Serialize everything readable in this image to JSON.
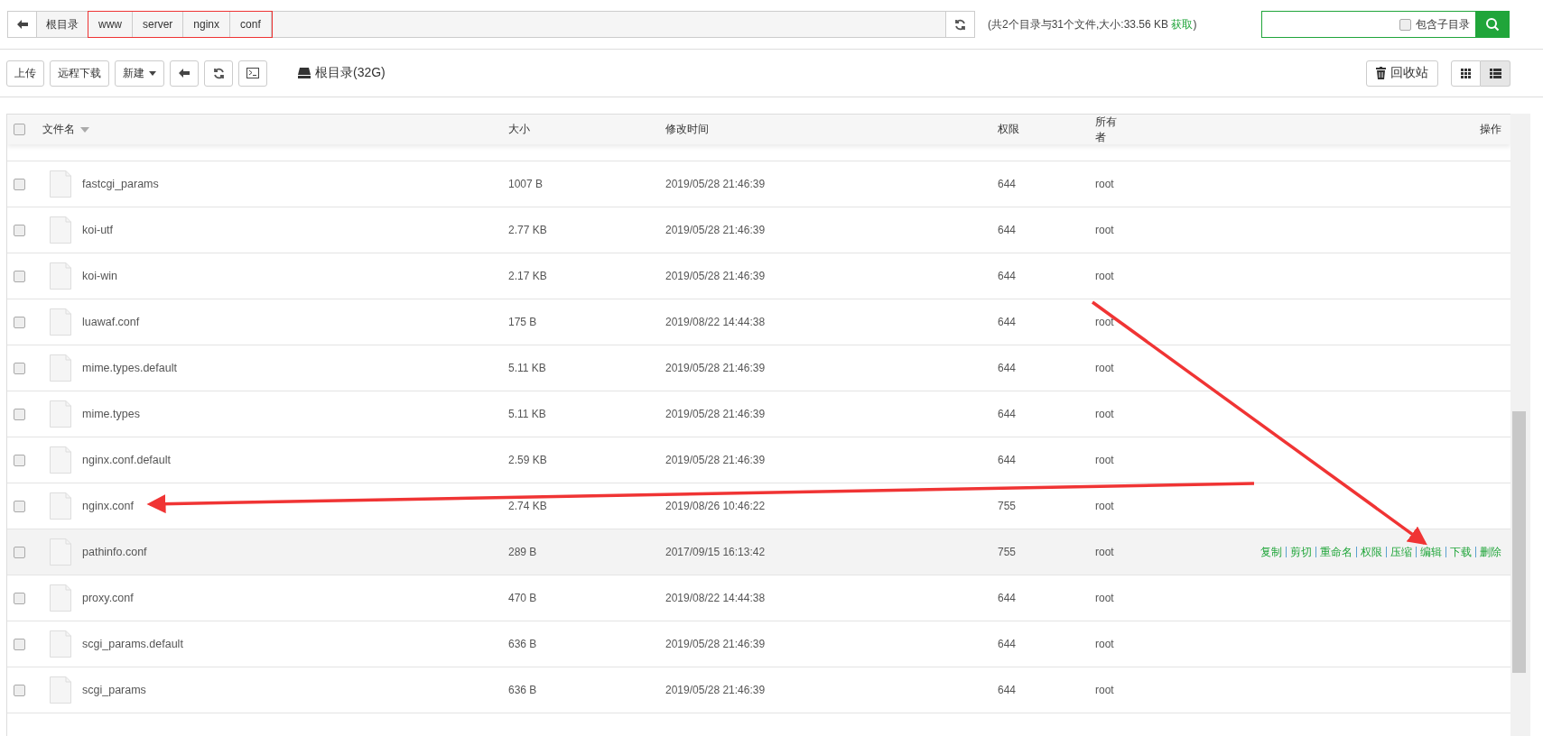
{
  "path_bar": {
    "root": "根目录",
    "segments": [
      "www",
      "server",
      "nginx",
      "conf"
    ],
    "highlighted": true
  },
  "summary": {
    "text": "(共2个目录与31个文件,大小:33.56 KB",
    "link": "获取",
    "close": ")"
  },
  "search": {
    "option_label": "包含子目录",
    "option_checked": false
  },
  "toolbar": {
    "buttons": [
      "上传",
      "远程下载"
    ],
    "new_button": "新建",
    "disk": "根目录(32G)",
    "recycle": "回收站",
    "views": [
      {
        "kind": "grid",
        "selected": false
      },
      {
        "kind": "list",
        "selected": true
      }
    ]
  },
  "table": {
    "columns": [
      "文件名",
      "大小",
      "修改时间",
      "权限",
      "所有者",
      "操作"
    ],
    "header_checked": false,
    "rows": [
      {
        "name": "fastcgi_params",
        "size": "1007 B",
        "modified": "2019/05/28 21:46:39",
        "permission": "644",
        "owner": "root",
        "checked": false,
        "highlighted": false
      },
      {
        "name": "koi-utf",
        "size": "2.77 KB",
        "modified": "2019/05/28 21:46:39",
        "permission": "644",
        "owner": "root",
        "checked": false,
        "highlighted": false
      },
      {
        "name": "koi-win",
        "size": "2.17 KB",
        "modified": "2019/05/28 21:46:39",
        "permission": "644",
        "owner": "root",
        "checked": false,
        "highlighted": false
      },
      {
        "name": "luawaf.conf",
        "size": "175 B",
        "modified": "2019/08/22 14:44:38",
        "permission": "644",
        "owner": "root",
        "checked": false,
        "highlighted": false
      },
      {
        "name": "mime.types.default",
        "size": "5.11 KB",
        "modified": "2019/05/28 21:46:39",
        "permission": "644",
        "owner": "root",
        "checked": false,
        "highlighted": false
      },
      {
        "name": "mime.types",
        "size": "5.11 KB",
        "modified": "2019/05/28 21:46:39",
        "permission": "644",
        "owner": "root",
        "checked": false,
        "highlighted": false
      },
      {
        "name": "nginx.conf.default",
        "size": "2.59 KB",
        "modified": "2019/05/28 21:46:39",
        "permission": "644",
        "owner": "root",
        "checked": false,
        "highlighted": false
      },
      {
        "name": "nginx.conf",
        "size": "2.74 KB",
        "modified": "2019/08/26 10:46:22",
        "permission": "755",
        "owner": "root",
        "checked": false,
        "highlighted": false
      },
      {
        "name": "pathinfo.conf",
        "size": "289 B",
        "modified": "2017/09/15 16:13:42",
        "permission": "755",
        "owner": "root",
        "checked": false,
        "highlighted": true,
        "actions": [
          "复制",
          "剪切",
          "重命名",
          "权限",
          "压缩",
          "编辑",
          "下载",
          "删除"
        ]
      },
      {
        "name": "proxy.conf",
        "size": "470 B",
        "modified": "2019/08/22 14:44:38",
        "permission": "644",
        "owner": "root",
        "checked": false,
        "highlighted": false
      },
      {
        "name": "scgi_params.default",
        "size": "636 B",
        "modified": "2019/05/28 21:46:39",
        "permission": "644",
        "owner": "root",
        "checked": false,
        "highlighted": false
      },
      {
        "name": "scgi_params",
        "size": "636 B",
        "modified": "2019/05/28 21:46:39",
        "permission": "644",
        "owner": "root",
        "checked": false,
        "highlighted": false
      }
    ]
  },
  "annotations": [
    {
      "kind": "arrow"
    },
    {
      "kind": "arrow"
    }
  ]
}
